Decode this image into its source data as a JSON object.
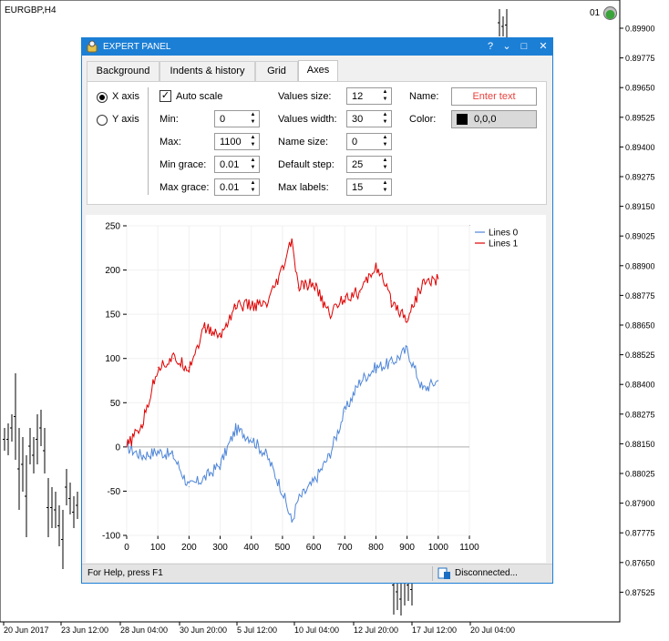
{
  "symbol": "EURGBP,H4",
  "account_number": "01",
  "price_axis": [
    "0.89900",
    "0.89775",
    "0.89650",
    "0.89525",
    "0.89400",
    "0.89275",
    "0.89150",
    "0.89025",
    "0.88900",
    "0.88775",
    "0.88650",
    "0.88525",
    "0.88400",
    "0.88275",
    "0.88150",
    "0.88025",
    "0.87900",
    "0.87775",
    "0.87650",
    "0.87525"
  ],
  "time_axis": [
    "20 Jun 2017",
    "23 Jun 12:00",
    "28 Jun 04:00",
    "30 Jun 20:00",
    "5 Jul 12:00",
    "10 Jul 04:00",
    "12 Jul 20:00",
    "17 Jul 12:00",
    "20 Jul 04:00"
  ],
  "panel": {
    "title": "EXPERT PANEL",
    "buttons": {
      "help": "?",
      "minimize": "⌄",
      "maximize": "□",
      "close": "✕"
    },
    "tabs": [
      {
        "label": "Background"
      },
      {
        "label": "Indents & history"
      },
      {
        "label": "Grid"
      },
      {
        "label": "Axes",
        "active": true
      }
    ],
    "axes_tab": {
      "x_axis_label": "X axis",
      "y_axis_label": "Y axis",
      "selected_axis": "X axis",
      "auto_scale_label": "Auto scale",
      "auto_scale_checked": true,
      "min_label": "Min:",
      "min_value": "0",
      "max_label": "Max:",
      "max_value": "1100",
      "min_grace_label": "Min grace:",
      "min_grace_value": "0.01",
      "max_grace_label": "Max grace:",
      "max_grace_value": "0.01",
      "values_size_label": "Values size:",
      "values_size_value": "12",
      "values_width_label": "Values width:",
      "values_width_value": "30",
      "name_size_label": "Name size:",
      "name_size_value": "0",
      "default_step_label": "Default step:",
      "default_step_value": "25",
      "max_labels_label": "Max labels:",
      "max_labels_value": "15",
      "name_label": "Name:",
      "name_placeholder": "Enter text",
      "color_label": "Color:",
      "color_value": "0,0,0",
      "color_swatch": "#000000"
    },
    "status": {
      "help_text": "For Help, press F1",
      "connection": "Disconnected..."
    }
  },
  "chart_data": {
    "type": "line",
    "title": "",
    "xlabel": "",
    "ylabel": "",
    "xlim": [
      0,
      1100
    ],
    "ylim": [
      -100,
      250
    ],
    "x_ticks": [
      "0",
      "100",
      "200",
      "300",
      "400",
      "500",
      "600",
      "700",
      "800",
      "900",
      "1000",
      "1100"
    ],
    "y_ticks": [
      "250",
      "200",
      "150",
      "100",
      "50",
      "0",
      "-50",
      "-100"
    ],
    "grid": true,
    "legend": "top-right",
    "x": [
      0,
      50,
      100,
      150,
      200,
      250,
      300,
      350,
      400,
      450,
      500,
      530,
      550,
      600,
      650,
      700,
      750,
      800,
      850,
      900,
      950,
      1000
    ],
    "series": [
      {
        "name": "Lines 0",
        "color": "#4f86d8",
        "values": [
          0,
          -10,
          -5,
          -10,
          -45,
          -35,
          -20,
          20,
          10,
          -10,
          -50,
          -85,
          -60,
          -40,
          -10,
          40,
          75,
          90,
          95,
          110,
          65,
          75
        ]
      },
      {
        "name": "Lines 1",
        "color": "#e00000",
        "values": [
          0,
          25,
          90,
          100,
          90,
          135,
          125,
          160,
          160,
          160,
          200,
          235,
          180,
          185,
          150,
          170,
          175,
          205,
          165,
          145,
          185,
          190
        ]
      }
    ]
  }
}
